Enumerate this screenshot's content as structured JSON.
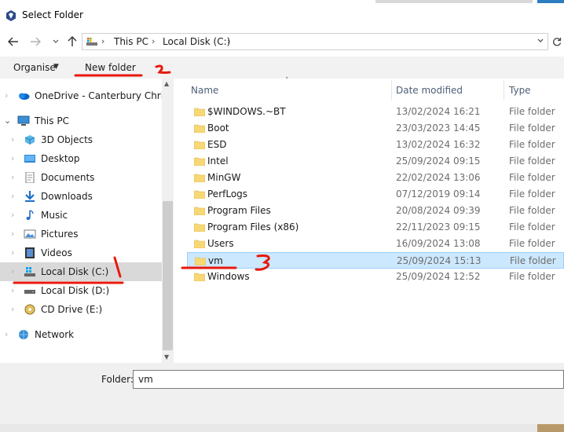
{
  "window": {
    "title": "Select Folder"
  },
  "address_bar": {
    "breadcrumbs": [
      "This PC",
      "Local Disk (C:)"
    ]
  },
  "toolbar": {
    "organise_label": "Organise",
    "new_folder_label": "New folder"
  },
  "nav_pane": {
    "items": [
      {
        "label": "OneDrive - Canterbury Christ C",
        "icon": "onedrive-icon",
        "selected": false
      },
      {
        "label": "This PC",
        "icon": "pc-icon",
        "selected": false
      },
      {
        "label": "3D Objects",
        "icon": "3d-objects-icon",
        "selected": false
      },
      {
        "label": "Desktop",
        "icon": "desktop-icon",
        "selected": false
      },
      {
        "label": "Documents",
        "icon": "documents-icon",
        "selected": false
      },
      {
        "label": "Downloads",
        "icon": "downloads-icon",
        "selected": false
      },
      {
        "label": "Music",
        "icon": "music-icon",
        "selected": false
      },
      {
        "label": "Pictures",
        "icon": "pictures-icon",
        "selected": false
      },
      {
        "label": "Videos",
        "icon": "videos-icon",
        "selected": false
      },
      {
        "label": "Local Disk (C:)",
        "icon": "windows-drive-icon",
        "selected": true
      },
      {
        "label": "Local Disk (D:)",
        "icon": "drive-icon",
        "selected": false
      },
      {
        "label": "CD Drive (E:)",
        "icon": "cd-drive-icon",
        "selected": false
      },
      {
        "label": "Network",
        "icon": "network-icon",
        "selected": false
      }
    ]
  },
  "file_list": {
    "columns": {
      "name": "Name",
      "date": "Date modified",
      "type": "Type"
    },
    "rows": [
      {
        "name": "$WINDOWS.~BT",
        "date": "13/02/2024 16:21",
        "type": "File folder"
      },
      {
        "name": "Boot",
        "date": "23/03/2023 14:45",
        "type": "File folder"
      },
      {
        "name": "ESD",
        "date": "13/02/2024 16:32",
        "type": "File folder"
      },
      {
        "name": "Intel",
        "date": "25/09/2024 09:15",
        "type": "File folder"
      },
      {
        "name": "MinGW",
        "date": "22/02/2024 13:06",
        "type": "File folder"
      },
      {
        "name": "PerfLogs",
        "date": "07/12/2019 09:14",
        "type": "File folder"
      },
      {
        "name": "Program Files",
        "date": "20/08/2024 09:39",
        "type": "File folder"
      },
      {
        "name": "Program Files (x86)",
        "date": "22/11/2023 09:15",
        "type": "File folder"
      },
      {
        "name": "Users",
        "date": "16/09/2024 13:08",
        "type": "File folder"
      },
      {
        "name": "vm",
        "date": "25/09/2024 15:13",
        "type": "File folder"
      },
      {
        "name": "Windows",
        "date": "25/09/2024 12:52",
        "type": "File folder"
      }
    ],
    "selected_row": "vm"
  },
  "footer": {
    "folder_label": "Folder:",
    "folder_value": "vm"
  },
  "annotations": {
    "label_1": "1",
    "label_2": "2",
    "label_3": "3",
    "color": "#e8190c"
  },
  "colors": {
    "selection_bg": "#cce8ff",
    "selection_border": "#99d1ff",
    "folder_yellow": "#f8d775"
  }
}
